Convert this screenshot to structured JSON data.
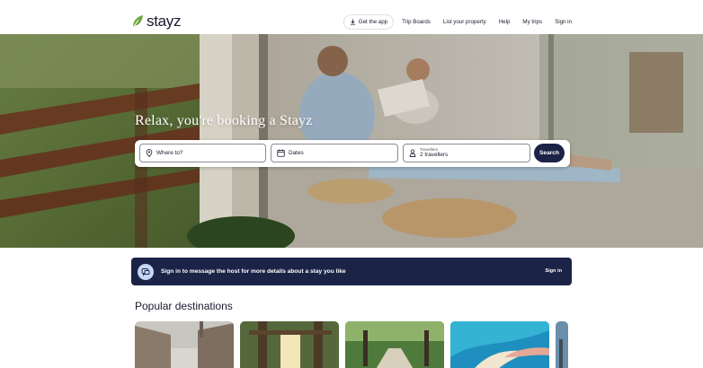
{
  "brand": {
    "name": "stayz",
    "color": "#1b2347",
    "leaf_color": "#6ea83a"
  },
  "nav": {
    "get_app": "Get the app",
    "trip_boards": "Trip Boards",
    "list_property": "List your property",
    "help": "Help",
    "my_trips": "My trips",
    "sign_in": "Sign in"
  },
  "hero": {
    "title": "Relax, you're booking a Stayz"
  },
  "search": {
    "where_placeholder": "Where to?",
    "dates_placeholder": "Dates",
    "travellers_label": "Travellers",
    "travellers_value": "2 travellers",
    "button": "Search"
  },
  "banner": {
    "text": "Sign in to message the host for more details about a stay you like",
    "sign_in": "Sign in"
  },
  "popular": {
    "title": "Popular destinations"
  },
  "icons": [
    "download-icon",
    "location-pin-icon",
    "calendar-icon",
    "person-icon",
    "message-icon"
  ]
}
